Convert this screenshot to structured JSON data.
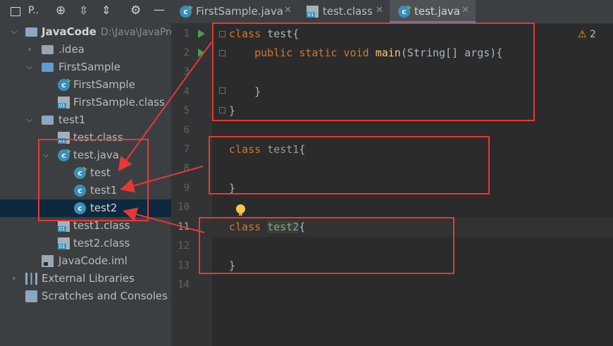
{
  "project_panel": {
    "title": "P..",
    "toolbar_icons": [
      "crosshair-icon",
      "expand-all-icon",
      "collapse-all-icon",
      "gear-icon",
      "minimize-icon"
    ],
    "tree": [
      {
        "label": "JavaCode",
        "path": "D:\\Java\\JavaPro",
        "icon": "module-folder-icon",
        "expanded": true
      },
      {
        "label": ".idea",
        "icon": "folder-icon",
        "expanded": false
      },
      {
        "label": "FirstSample",
        "icon": "source-folder-icon",
        "expanded": true
      },
      {
        "label": "FirstSample",
        "icon": "java-class-icon"
      },
      {
        "label": "FirstSample.class",
        "icon": "class-file-icon"
      },
      {
        "label": "test1",
        "icon": "folder-icon",
        "expanded": true
      },
      {
        "label": "test.class",
        "icon": "class-file-icon"
      },
      {
        "label": "test.java",
        "icon": "java-file-icon",
        "expanded": true
      },
      {
        "label": "test",
        "icon": "java-class-icon"
      },
      {
        "label": "test1",
        "icon": "java-class-icon"
      },
      {
        "label": "test2",
        "icon": "java-class-icon",
        "selected": true
      },
      {
        "label": "test1.class",
        "icon": "class-file-icon"
      },
      {
        "label": "test2.class",
        "icon": "class-file-icon"
      },
      {
        "label": "JavaCode.iml",
        "icon": "iml-file-icon"
      },
      {
        "label": "External Libraries",
        "icon": "libraries-icon",
        "expanded": false
      },
      {
        "label": "Scratches and Consoles",
        "icon": "scratches-icon"
      }
    ]
  },
  "tabs": [
    {
      "label": "FirstSample.java",
      "icon": "java-class-icon"
    },
    {
      "label": "test.class",
      "icon": "class-file-icon"
    },
    {
      "label": "test.java",
      "icon": "java-class-icon",
      "active": true
    }
  ],
  "inspection": {
    "count": "2",
    "icon": "warning-icon"
  },
  "editor": {
    "line_numbers": [
      "1",
      "2",
      "3",
      "4",
      "5",
      "6",
      "7",
      "8",
      "9",
      "10",
      "11",
      "12",
      "13",
      "14"
    ],
    "current_line": "11",
    "code": {
      "l1_kw": "class",
      "l1_name": "test",
      "l1_brace": "{",
      "l2_kw": "public static void",
      "l2_fn": "main",
      "l2_args": "(String[] args){",
      "l4": "}",
      "l5": "}",
      "l7_kw": "class",
      "l7_name": "test1",
      "l7_brace": "{",
      "l9": "}",
      "l11_kw": "class",
      "l11_name": "test2",
      "l11_brace": "{",
      "l13": "}"
    }
  },
  "colors": {
    "annotation": "#e53935",
    "keyword": "#cc7832",
    "method": "#ffc66d",
    "selection": "#0d293e"
  }
}
